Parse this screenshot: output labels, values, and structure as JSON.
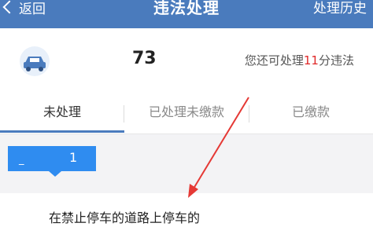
{
  "topbar": {
    "back_label": "返回",
    "title": "违法处理",
    "history_label": "处理历史"
  },
  "summary": {
    "score": "73",
    "remaining_prefix": "您还可处理",
    "remaining_count": "11",
    "remaining_suffix": "分违法"
  },
  "tabs": [
    {
      "label": "未处理",
      "active": true
    },
    {
      "label": "已处理未缴款",
      "active": false
    },
    {
      "label": "已缴款",
      "active": false
    }
  ],
  "badge": {
    "prefix": "_",
    "count": "1"
  },
  "violation": {
    "text": "在禁止停车的道路上停车的"
  },
  "colors": {
    "brand": "#4a7bbd",
    "badge": "#2f8cf0",
    "highlight": "#e02828",
    "arrow": "#e53935"
  },
  "icons": {
    "back": "chevron-left-icon",
    "car": "car-icon"
  }
}
